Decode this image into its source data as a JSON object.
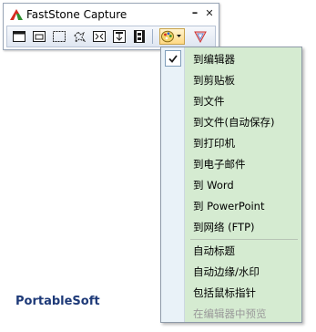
{
  "window": {
    "title": "FastStone Capture",
    "minimize_label": "–",
    "close_label": "✕"
  },
  "toolbar": {
    "tools": [
      "capture-window-icon",
      "capture-object-icon",
      "capture-rectangle-icon",
      "capture-freehand-icon",
      "capture-fullscreen-icon",
      "capture-scrolling-icon",
      "capture-video-icon",
      "output-palette-icon",
      "settings-icon"
    ]
  },
  "menu": {
    "items": [
      {
        "label": "到编辑器",
        "checked": true
      },
      {
        "label": "到剪贴板"
      },
      {
        "label": "到文件"
      },
      {
        "label": "到文件(自动保存)"
      },
      {
        "label": "到打印机"
      },
      {
        "label": "到电子邮件"
      },
      {
        "label": "到 Word"
      },
      {
        "label": "到 PowerPoint"
      },
      {
        "label": "到网络 (FTP)"
      },
      {
        "label": "自动标题"
      },
      {
        "label": "自动边缘/水印"
      },
      {
        "label": "包括鼠标指针"
      },
      {
        "label": "在编辑器中预览",
        "disabled": true
      }
    ]
  },
  "brand": "PortableSoft",
  "colors": {
    "menu_bg": "#d5ebd1",
    "brand_text": "#1e3a78",
    "disabled_text": "#9a9a9a"
  }
}
